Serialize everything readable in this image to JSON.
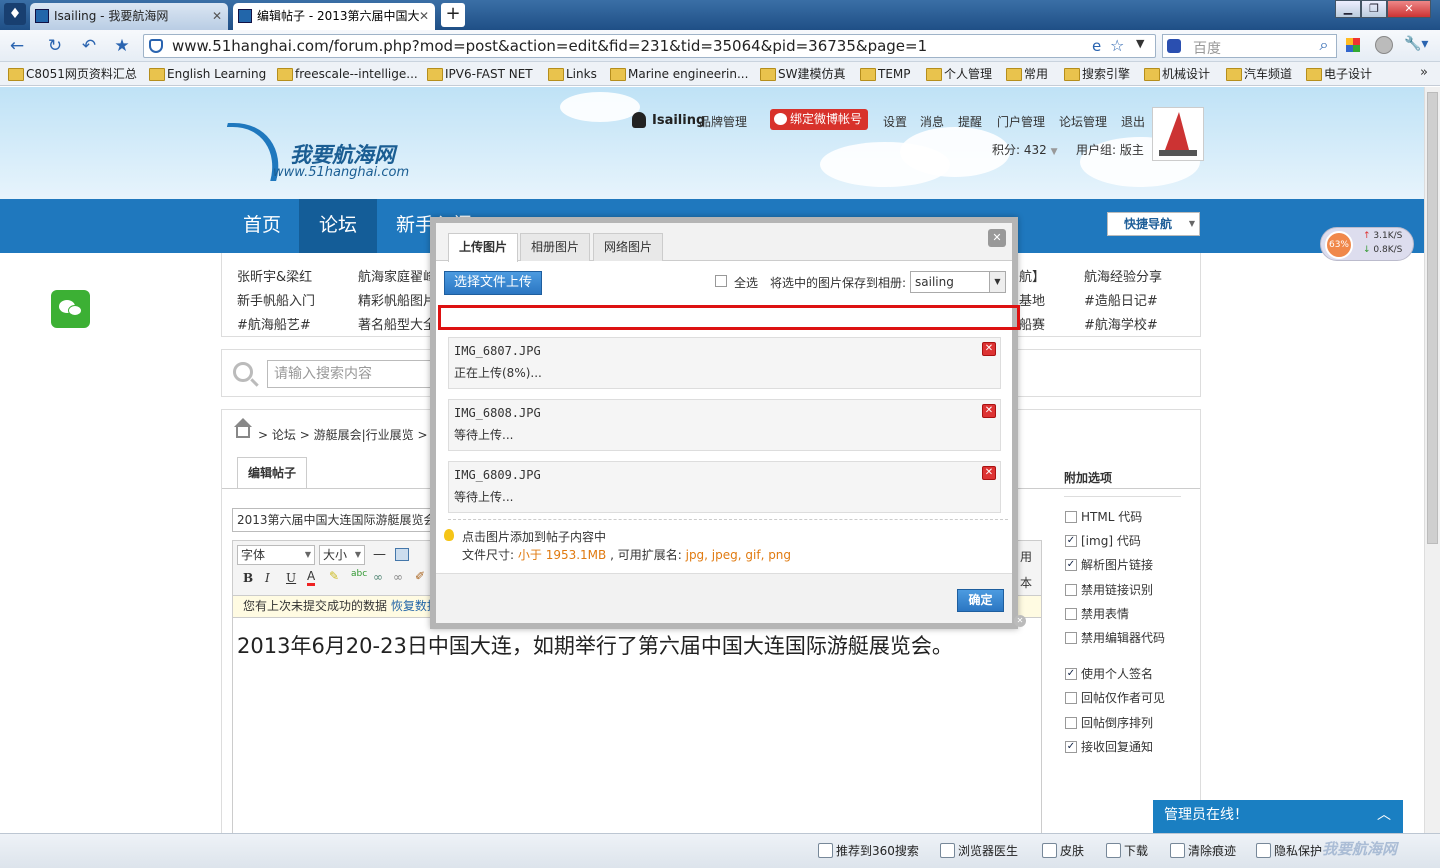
{
  "browser": {
    "tabs": [
      {
        "label": "Isailing - 我要航海网",
        "close": "✕"
      },
      {
        "label": "编辑帖子 - 2013第六届中国大",
        "close": "✕"
      }
    ],
    "new_tab": "+",
    "window_buttons": [
      "▁",
      "❐",
      "✕"
    ],
    "url": "www.51hanghai.com/forum.php?mod=post&action=edit&fid=231&tid=35064&pid=36735&page=1",
    "search_placeholder": "百度",
    "bookmarks": [
      "C8051网页资料汇总",
      "English Learning",
      "freescale--intellige...",
      "IPV6-FAST NET",
      "Links",
      "Marine engineerin...",
      "SW建模仿真",
      "TEMP",
      "个人管理",
      "常用",
      "搜索引擎",
      "机械设计",
      "汽车频道",
      "电子设计"
    ],
    "bookmarks_more": "»"
  },
  "site": {
    "logo_text": "我要航海网",
    "logo_url": "www.51hanghai.com",
    "user": "Isailing",
    "user_links": [
      "品牌管理"
    ],
    "weibo_button": "绑定微博帐号",
    "top_links": [
      "设置",
      "消息",
      "提醒",
      "门户管理",
      "论坛管理",
      "退出"
    ],
    "points": "积分: 432",
    "usergroup": "用户组: 版主",
    "main_nav": [
      "首页",
      "论坛",
      "新手入门",
      "",
      ""
    ],
    "quick_nav": "快捷导航",
    "sub_nav_col1": [
      "张昕宇&梁红",
      "新手帆船入门",
      "#航海船艺#"
    ],
    "sub_nav_col2": [
      "航海家庭翟峰",
      "精彩帆船图片",
      "著名船型大全"
    ],
    "sub_nav_col5": [
      "航】",
      "基地",
      "船赛"
    ],
    "sub_nav_col6": [
      "航海经验分享",
      "#造船日记#",
      "#航海学校#"
    ],
    "search_placeholder": "请输入搜索内容",
    "breadcrumb": [
      "论坛",
      "游艇展会|行业展览"
    ],
    "edit_tab": "编辑帖子",
    "subject": "2013第六届中国大连国际游艇展览会",
    "editor": {
      "font_select": "字体",
      "size_select": "大小",
      "restore_text": "您有上次未提交成功的数据",
      "restore_link": "恢复数据",
      "right_labels": [
        "用",
        "本"
      ],
      "body": "2013年6月20-23日中国大连，如期举行了第六届中国大连国际游艇展览会。"
    },
    "sidebar": {
      "title": "附加选项",
      "options": [
        {
          "label": "HTML 代码",
          "checked": false
        },
        {
          "label": "[img] 代码",
          "checked": true
        },
        {
          "label": "解析图片链接",
          "checked": true
        },
        {
          "label": "禁用链接识别",
          "checked": false
        },
        {
          "label": "禁用表情",
          "checked": false
        },
        {
          "label": "禁用编辑器代码",
          "checked": false
        },
        {
          "label": "使用个人签名",
          "checked": true
        },
        {
          "label": "回帖仅作者可见",
          "checked": false
        },
        {
          "label": "回帖倒序排列",
          "checked": false
        },
        {
          "label": "接收回复通知",
          "checked": true
        }
      ]
    },
    "admin_online": "管理员在线！",
    "admin_toggle": "︿",
    "net_speed": {
      "percent": "63%",
      "up": "3.1K/S",
      "down": "0.8K/S"
    }
  },
  "dialog": {
    "tabs": [
      "上传图片",
      "相册图片",
      "网络图片"
    ],
    "close": "✕",
    "upload_button": "选择文件上传",
    "select_all": "全选",
    "album_label": "将选中的图片保存到相册:",
    "album_value": "sailing",
    "files": [
      {
        "name": "IMG_6807.JPG",
        "status": "正在上传(8%)..."
      },
      {
        "name": "IMG_6808.JPG",
        "status": "等待上传..."
      },
      {
        "name": "IMG_6809.JPG",
        "status": "等待上传..."
      }
    ],
    "tip": "点击图片添加到帖子内容中",
    "size_label": "文件尺寸:",
    "size_value": "小于 1953.1MB",
    "ext_label": ", 可用扩展名:",
    "ext_value": "jpg, jpeg, gif, png",
    "ok_button": "确定"
  },
  "statusbar": [
    "推荐到360搜索",
    "浏览器医生",
    "皮肤",
    "下载",
    "清除痕迹",
    "隐私保护"
  ],
  "watermark": "我要航海网"
}
